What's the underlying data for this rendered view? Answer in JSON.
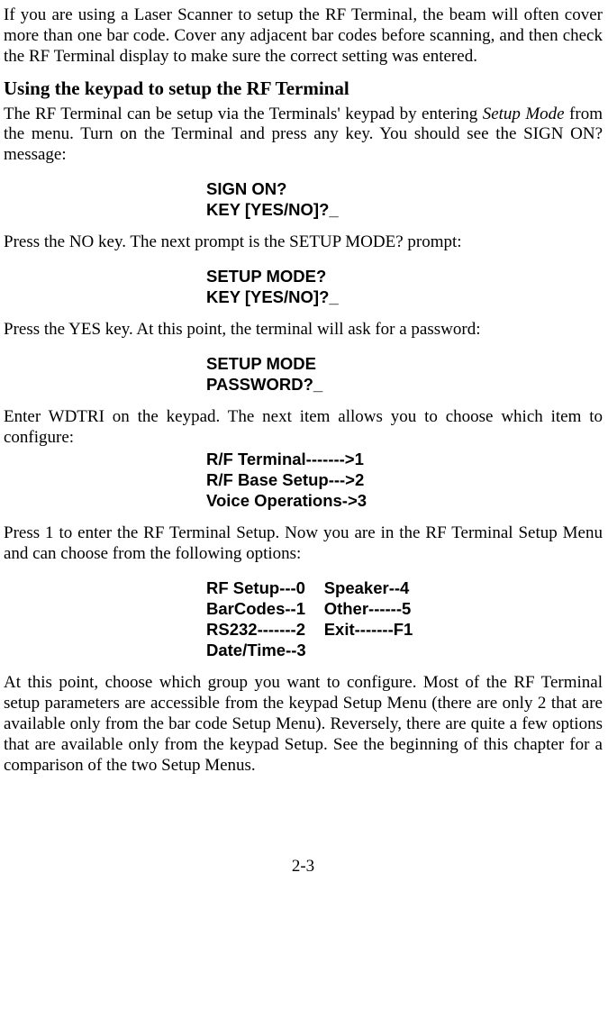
{
  "p_intro": "If you are using a Laser Scanner to setup the RF Terminal, the beam will often cover more than one bar code. Cover any adjacent bar codes before scanning, and then check the RF Terminal display to make sure the correct setting was entered.",
  "heading": "Using the keypad to setup the RF Terminal",
  "p_setup1a": "The RF Terminal can be setup via the Terminals' keypad by entering ",
  "p_setup1b": "Setup Mode",
  "p_setup1c": " from the menu. Turn on the Terminal and press any key. You should see the SIGN ON? message:",
  "prompt1_l1": "SIGN ON?",
  "prompt1_l2": "KEY [YES/NO]?_",
  "p_no": "Press the NO key.  The next prompt is the SETUP MODE? prompt:",
  "prompt2_l1": "SETUP MODE?",
  "prompt2_l2": "KEY [YES/NO]?_",
  "p_yes": "Press the YES key.  At this point, the terminal will ask for a password:",
  "prompt3_l1": "SETUP MODE",
  "prompt3_l2": "PASSWORD?_",
  "p_wdtri": "Enter WDTRI on the keypad.  The next item allows you to choose which item to configure:",
  "menu1_l1": "R/F Terminal------->1",
  "menu1_l2": "R/F Base Setup--->2",
  "menu1_l3": "Voice Operations->3",
  "p_press1": "Press 1 to enter the RF Terminal Setup. Now you are in the RF Terminal Setup Menu and can choose from the following options:",
  "menu2_c1_l1": "RF Setup---0",
  "menu2_c1_l2": "BarCodes--1",
  "menu2_c1_l3": "RS232-------2",
  "menu2_c1_l4": "Date/Time--3",
  "menu2_c2_l1": "Speaker--4",
  "menu2_c2_l2": "Other------5",
  "menu2_c2_l3": "Exit-------F1",
  "p_final": "At this point, choose which group you want to configure. Most of the RF Terminal setup parameters are accessible from the keypad Setup Menu (there are only 2 that are available only from the bar code Setup Menu). Reversely, there are quite a few options that are available only from the keypad Setup.  See the beginning of this chapter for a comparison of the two Setup Menus.",
  "pagenum": "2-3"
}
